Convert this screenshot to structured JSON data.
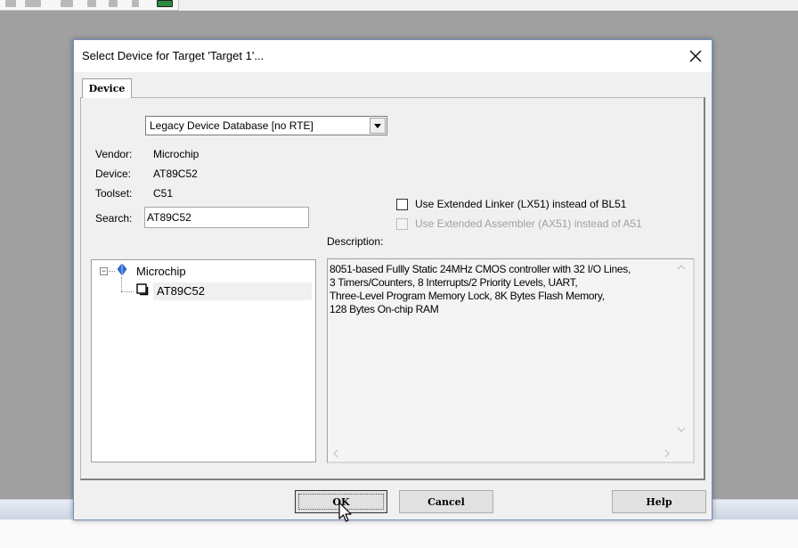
{
  "dialog": {
    "title": "Select Device for Target 'Target 1'...",
    "close_glyph": "✕"
  },
  "tabs": [
    {
      "label": "Device"
    }
  ],
  "database_select": {
    "value": "Legacy Device Database [no RTE]"
  },
  "fields": {
    "vendor_label": "Vendor:",
    "vendor_value": "Microchip",
    "device_label": "Device:",
    "device_value": "AT89C52",
    "toolset_label": "Toolset:",
    "toolset_value": "C51",
    "search_label": "Search:",
    "search_value": "AT89C52"
  },
  "options": {
    "extended_linker": "Use Extended Linker (LX51) instead of BL51",
    "extended_assembler": "Use Extended Assembler (AX51) instead of A51"
  },
  "description": {
    "label": "Description:",
    "lines": [
      "8051-based Fullly Static 24MHz CMOS controller with 32  I/O Lines,",
      "3 Timers/Counters, 8 Interrupts/2 Priority Levels, UART,",
      "Three-Level Program Memory Lock, 8K Bytes Flash Memory,",
      "128 Bytes On-chip RAM"
    ]
  },
  "tree": {
    "vendor": "Microchip",
    "device": "AT89C52",
    "expander": "−"
  },
  "buttons": {
    "ok": "OK",
    "cancel": "Cancel",
    "help": "Help"
  },
  "colors": {
    "dialog_border": "#6f8fbf",
    "dialog_bg": "#f0f0f0",
    "vendor_icon": "#2f6fd6"
  }
}
